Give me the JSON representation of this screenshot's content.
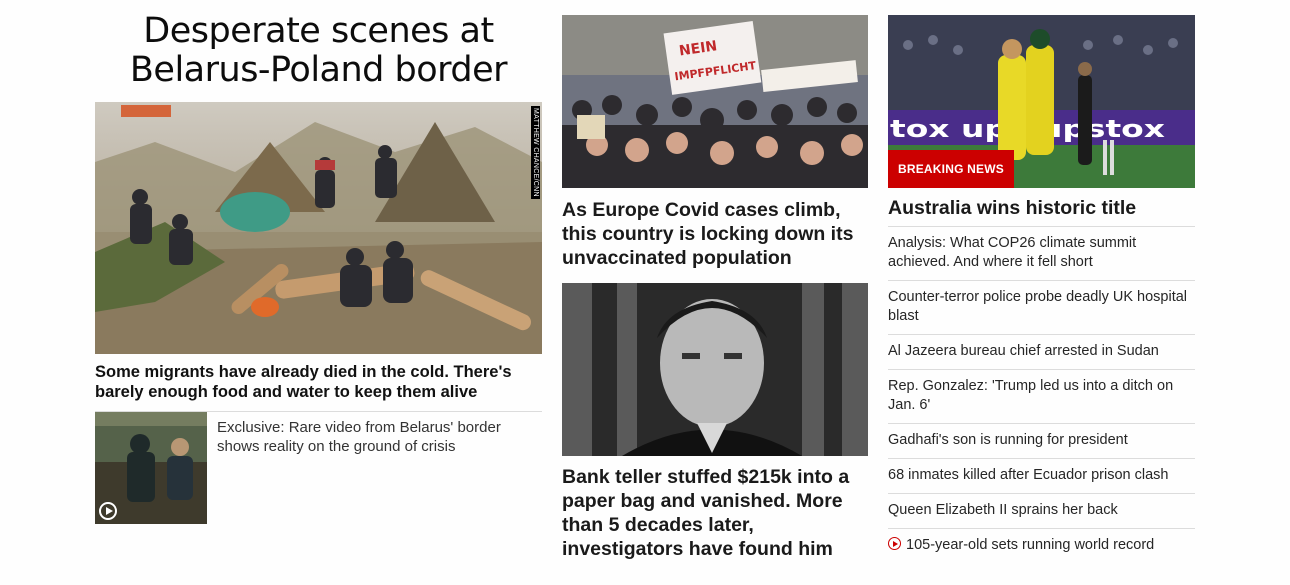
{
  "col1": {
    "title": "Desperate scenes at Belarus-Poland border",
    "photo_credit": "MATTHEW CHANCE/CNN",
    "caption": "Some migrants have already died in the cold. There's barely enough food and water to keep them alive",
    "sub_story": "Exclusive: Rare video from Belarus' border shows reality on the ground of crisis",
    "sub_icon": "play-icon"
  },
  "col2": {
    "story1": "As Europe Covid cases climb, this country is locking down its unvaccinated population",
    "sign_text_1": "NEIN",
    "sign_text_2": "IMPFPFLICHT",
    "story2": "Bank teller stuffed $215k into a paper bag and vanished. More than 5 decades later, investigators have found him"
  },
  "col3": {
    "badge": "BREAKING NEWS",
    "banner_text": "tox ups upstox",
    "headline": "Australia wins historic title",
    "links": [
      "Analysis: What COP26 climate summit achieved. And where it fell short",
      "Counter-terror police probe deadly UK hospital blast",
      "Al Jazeera bureau chief arrested in Sudan",
      "Rep. Gonzalez: 'Trump led us into a ditch on Jan. 6'",
      "Gadhafi's son is running for president",
      "68 inmates killed after Ecuador prison clash",
      "Queen Elizabeth II sprains her back",
      "105-year-old sets running world record"
    ],
    "last_link_icon": "video-play-icon"
  },
  "colors": {
    "accent": "#cc0000",
    "text": "#262626",
    "rule": "#dcdcdc"
  }
}
